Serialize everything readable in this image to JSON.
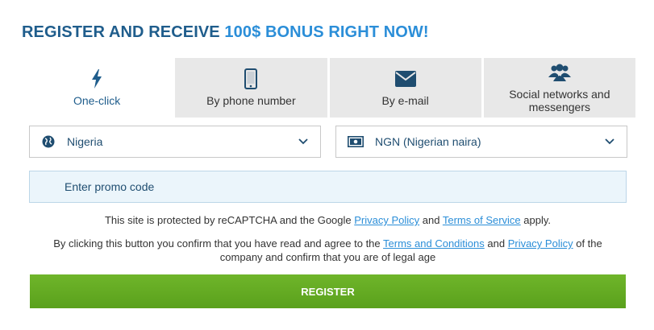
{
  "headline": {
    "main": "REGISTER AND RECEIVE ",
    "accent": "100$ BONUS RIGHT NOW!"
  },
  "tabs": [
    {
      "label": "One-click",
      "icon": "lightning-icon",
      "active": true
    },
    {
      "label": "By phone number",
      "icon": "smartphone-icon",
      "active": false
    },
    {
      "label": "By e-mail",
      "icon": "envelope-icon",
      "active": false
    },
    {
      "label": "Social networks and messengers",
      "icon": "users-group-icon",
      "active": false
    }
  ],
  "country_select": {
    "value": "Nigeria",
    "icon": "globe-icon"
  },
  "currency_select": {
    "value": "NGN (Nigerian naira)",
    "icon": "banknote-icon"
  },
  "promo": {
    "placeholder": "Enter promo code"
  },
  "recaptcha": {
    "pre": "This site is protected by reCAPTCHA and the Google ",
    "privacy": "Privacy Policy",
    "and": " and ",
    "terms": "Terms of Service",
    "post": " apply."
  },
  "consent": {
    "pre": "By clicking this button you confirm that you have read and agree to the ",
    "terms": "Terms and Conditions",
    "and": " and ",
    "privacy": "Privacy Policy",
    "post": " of the company and confirm that you are of legal age"
  },
  "register_button": {
    "label": "REGISTER"
  },
  "colors": {
    "brand": "#1f5d8c",
    "accent": "#2b8ed8",
    "register": "#5fa61f"
  }
}
